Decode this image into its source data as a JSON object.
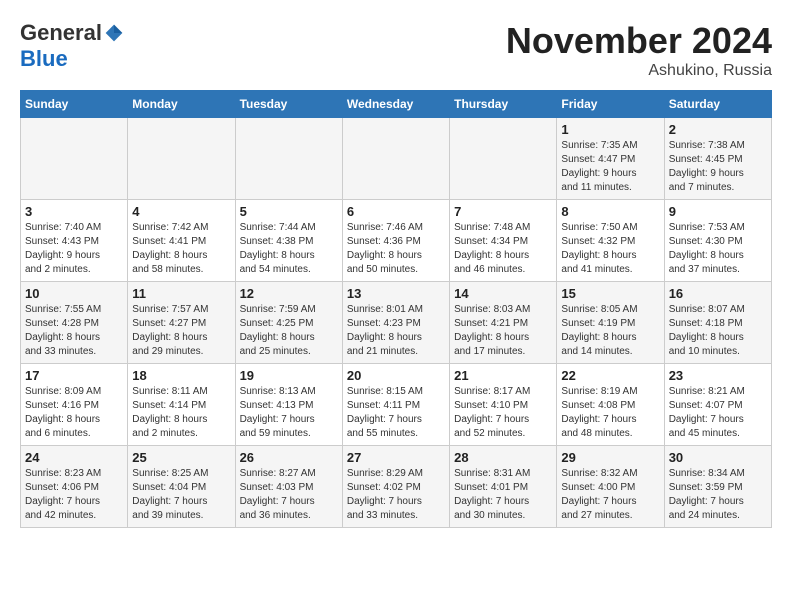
{
  "header": {
    "logo_general": "General",
    "logo_blue": "Blue",
    "month_title": "November 2024",
    "location": "Ashukino, Russia"
  },
  "weekdays": [
    "Sunday",
    "Monday",
    "Tuesday",
    "Wednesday",
    "Thursday",
    "Friday",
    "Saturday"
  ],
  "weeks": [
    [
      {
        "day": "",
        "info": ""
      },
      {
        "day": "",
        "info": ""
      },
      {
        "day": "",
        "info": ""
      },
      {
        "day": "",
        "info": ""
      },
      {
        "day": "",
        "info": ""
      },
      {
        "day": "1",
        "info": "Sunrise: 7:35 AM\nSunset: 4:47 PM\nDaylight: 9 hours\nand 11 minutes."
      },
      {
        "day": "2",
        "info": "Sunrise: 7:38 AM\nSunset: 4:45 PM\nDaylight: 9 hours\nand 7 minutes."
      }
    ],
    [
      {
        "day": "3",
        "info": "Sunrise: 7:40 AM\nSunset: 4:43 PM\nDaylight: 9 hours\nand 2 minutes."
      },
      {
        "day": "4",
        "info": "Sunrise: 7:42 AM\nSunset: 4:41 PM\nDaylight: 8 hours\nand 58 minutes."
      },
      {
        "day": "5",
        "info": "Sunrise: 7:44 AM\nSunset: 4:38 PM\nDaylight: 8 hours\nand 54 minutes."
      },
      {
        "day": "6",
        "info": "Sunrise: 7:46 AM\nSunset: 4:36 PM\nDaylight: 8 hours\nand 50 minutes."
      },
      {
        "day": "7",
        "info": "Sunrise: 7:48 AM\nSunset: 4:34 PM\nDaylight: 8 hours\nand 46 minutes."
      },
      {
        "day": "8",
        "info": "Sunrise: 7:50 AM\nSunset: 4:32 PM\nDaylight: 8 hours\nand 41 minutes."
      },
      {
        "day": "9",
        "info": "Sunrise: 7:53 AM\nSunset: 4:30 PM\nDaylight: 8 hours\nand 37 minutes."
      }
    ],
    [
      {
        "day": "10",
        "info": "Sunrise: 7:55 AM\nSunset: 4:28 PM\nDaylight: 8 hours\nand 33 minutes."
      },
      {
        "day": "11",
        "info": "Sunrise: 7:57 AM\nSunset: 4:27 PM\nDaylight: 8 hours\nand 29 minutes."
      },
      {
        "day": "12",
        "info": "Sunrise: 7:59 AM\nSunset: 4:25 PM\nDaylight: 8 hours\nand 25 minutes."
      },
      {
        "day": "13",
        "info": "Sunrise: 8:01 AM\nSunset: 4:23 PM\nDaylight: 8 hours\nand 21 minutes."
      },
      {
        "day": "14",
        "info": "Sunrise: 8:03 AM\nSunset: 4:21 PM\nDaylight: 8 hours\nand 17 minutes."
      },
      {
        "day": "15",
        "info": "Sunrise: 8:05 AM\nSunset: 4:19 PM\nDaylight: 8 hours\nand 14 minutes."
      },
      {
        "day": "16",
        "info": "Sunrise: 8:07 AM\nSunset: 4:18 PM\nDaylight: 8 hours\nand 10 minutes."
      }
    ],
    [
      {
        "day": "17",
        "info": "Sunrise: 8:09 AM\nSunset: 4:16 PM\nDaylight: 8 hours\nand 6 minutes."
      },
      {
        "day": "18",
        "info": "Sunrise: 8:11 AM\nSunset: 4:14 PM\nDaylight: 8 hours\nand 2 minutes."
      },
      {
        "day": "19",
        "info": "Sunrise: 8:13 AM\nSunset: 4:13 PM\nDaylight: 7 hours\nand 59 minutes."
      },
      {
        "day": "20",
        "info": "Sunrise: 8:15 AM\nSunset: 4:11 PM\nDaylight: 7 hours\nand 55 minutes."
      },
      {
        "day": "21",
        "info": "Sunrise: 8:17 AM\nSunset: 4:10 PM\nDaylight: 7 hours\nand 52 minutes."
      },
      {
        "day": "22",
        "info": "Sunrise: 8:19 AM\nSunset: 4:08 PM\nDaylight: 7 hours\nand 48 minutes."
      },
      {
        "day": "23",
        "info": "Sunrise: 8:21 AM\nSunset: 4:07 PM\nDaylight: 7 hours\nand 45 minutes."
      }
    ],
    [
      {
        "day": "24",
        "info": "Sunrise: 8:23 AM\nSunset: 4:06 PM\nDaylight: 7 hours\nand 42 minutes."
      },
      {
        "day": "25",
        "info": "Sunrise: 8:25 AM\nSunset: 4:04 PM\nDaylight: 7 hours\nand 39 minutes."
      },
      {
        "day": "26",
        "info": "Sunrise: 8:27 AM\nSunset: 4:03 PM\nDaylight: 7 hours\nand 36 minutes."
      },
      {
        "day": "27",
        "info": "Sunrise: 8:29 AM\nSunset: 4:02 PM\nDaylight: 7 hours\nand 33 minutes."
      },
      {
        "day": "28",
        "info": "Sunrise: 8:31 AM\nSunset: 4:01 PM\nDaylight: 7 hours\nand 30 minutes."
      },
      {
        "day": "29",
        "info": "Sunrise: 8:32 AM\nSunset: 4:00 PM\nDaylight: 7 hours\nand 27 minutes."
      },
      {
        "day": "30",
        "info": "Sunrise: 8:34 AM\nSunset: 3:59 PM\nDaylight: 7 hours\nand 24 minutes."
      }
    ]
  ]
}
